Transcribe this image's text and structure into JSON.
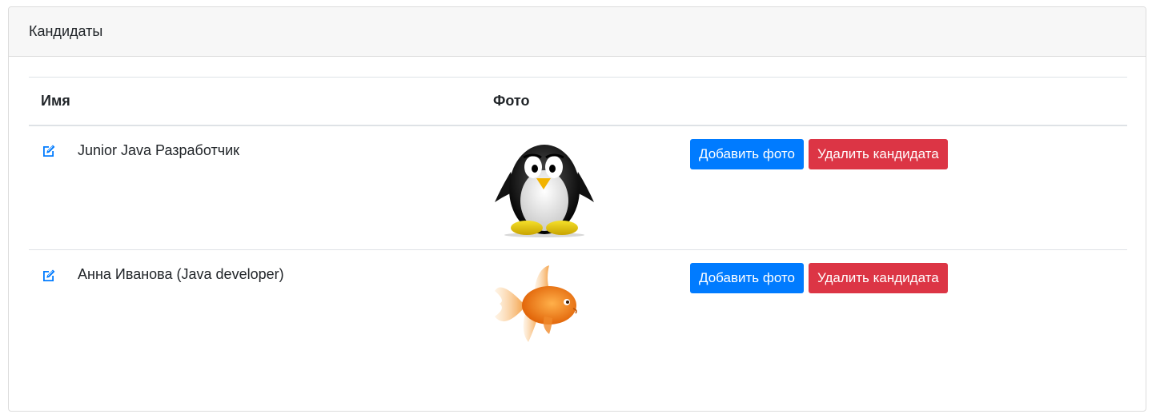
{
  "card": {
    "title": "Кандидаты"
  },
  "table": {
    "headers": [
      "Имя",
      "Фото",
      ""
    ],
    "rows": [
      {
        "name": "Junior Java Разработчик",
        "photo_icon": "penguin-photo",
        "add_photo_label": "Добавить фото",
        "delete_label": "Удалить кандидата"
      },
      {
        "name": "Анна Иванова (Java developer)",
        "photo_icon": "goldfish-photo",
        "add_photo_label": "Добавить фото",
        "delete_label": "Удалить кандидата"
      }
    ]
  },
  "colors": {
    "primary": "#007bff",
    "danger": "#dc3545",
    "edit_icon": "#007bff",
    "header_bg": "#f7f7f7"
  }
}
